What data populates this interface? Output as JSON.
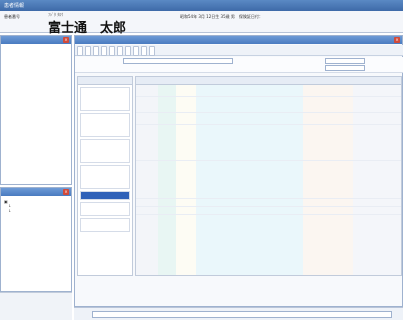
{
  "window": {
    "title": "患者情報"
  },
  "patient": {
    "id_label": "患者番号",
    "furigana": "ﾌｼﾞﾀ ﾀﾛｳ",
    "name": "富士通　太郎",
    "info1": "昭和54年 3月 12日生 35歳 男　保険証日付：",
    "info2": "",
    "right": ""
  },
  "left_pane1": {
    "title": "",
    "lines": [
      "",
      "",
      "",
      "",
      "",
      ""
    ]
  },
  "left_pane2": {
    "title": "",
    "tree": [
      "",
      "",
      ""
    ]
  },
  "main_pane": {
    "title": "",
    "toolbar": [
      "",
      "",
      "",
      "",
      "",
      "",
      "",
      "",
      "",
      ""
    ],
    "filter": {
      "label1": "",
      "label2": "",
      "label3": ""
    }
  },
  "doc_list": {
    "header": "",
    "cards": [
      {
        "date": "",
        "l1": "",
        "l2": "",
        "l3": ""
      },
      {
        "date": "",
        "l1": "",
        "l2": "",
        "l3": ""
      },
      {
        "date": "",
        "l1": "",
        "l2": "",
        "l3": ""
      },
      {
        "date": "",
        "l1": "",
        "l2": "",
        "l3": ""
      }
    ],
    "selected": "",
    "more": [
      {
        "date": "",
        "l1": ""
      },
      {
        "date": "",
        "l1": ""
      }
    ]
  },
  "grid": {
    "rows": [
      {
        "a": "",
        "b": "",
        "c": "",
        "d": "",
        "e": ""
      },
      {
        "a": "",
        "b": "",
        "c": "",
        "d": "",
        "e": ""
      },
      {
        "a": "",
        "b": "",
        "c": "",
        "d": "",
        "e": ""
      },
      {
        "a": "",
        "b": "",
        "c": "",
        "d": "",
        "e": ""
      },
      {
        "a": "",
        "b": "",
        "c": "",
        "d": "",
        "e": ""
      },
      {
        "a": "",
        "b": "",
        "c": "",
        "d": "",
        "e": ""
      },
      {
        "a": "",
        "b": "",
        "c": "",
        "d": "",
        "e": ""
      },
      {
        "a": "",
        "b": "",
        "c": "",
        "d": "",
        "e": ""
      },
      {
        "a": "",
        "b": "",
        "c": "",
        "d": "",
        "e": ""
      },
      {
        "a": "",
        "b": "",
        "c": "",
        "d": "",
        "e": ""
      }
    ]
  },
  "footer": {
    "label": "",
    "value": ""
  },
  "colors": {
    "title_bar": "#3e6aa8",
    "accent_red": "#c62828",
    "accent_blue": "#1d4fa3",
    "highlight": "#2f61b8"
  },
  "icons": {
    "close": "close-icon"
  }
}
